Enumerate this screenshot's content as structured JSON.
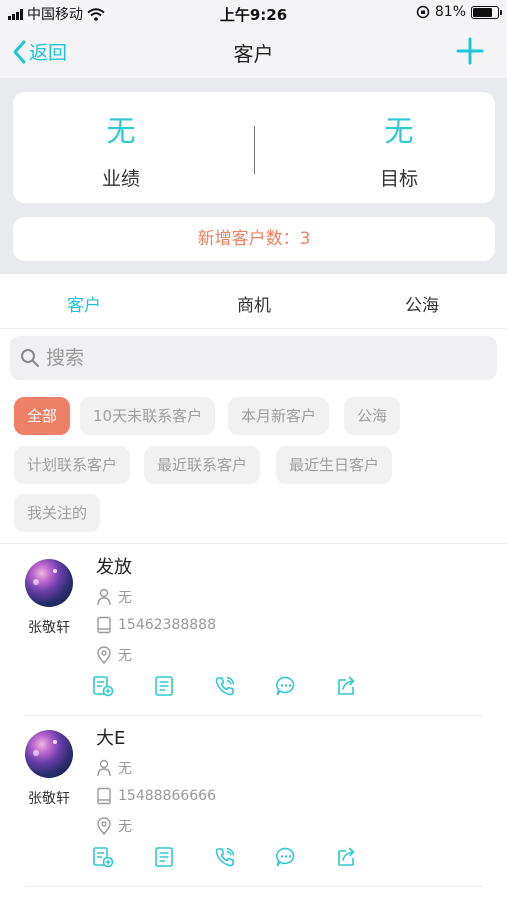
{
  "status_bar": {
    "carrier": "中国移动",
    "time": "上午9:26",
    "battery": "81%",
    "battery_level": 0.81
  },
  "navbar": {
    "back_label": "返回",
    "title": "客户"
  },
  "summary": {
    "metrics": [
      {
        "value": "无",
        "label": "业绩"
      },
      {
        "value": "无",
        "label": "目标"
      }
    ],
    "new_customers": "新增客户数：3"
  },
  "tabs": [
    "客户",
    "商机",
    "公海"
  ],
  "active_tab": 0,
  "search": {
    "placeholder": "搜索",
    "value": ""
  },
  "filters": [
    "全部",
    "10天未联系客户",
    "本月新客户",
    "公海",
    "计划联系客户",
    "最近联系客户",
    "最近生日客户",
    "我关注的"
  ],
  "active_filter": 0,
  "customers": [
    {
      "name": "发放",
      "owner": "张敬轩",
      "contact": "无",
      "phone": "15462388888",
      "address": "无"
    },
    {
      "name": "大E",
      "owner": "张敬轩",
      "contact": "无",
      "phone": "15488866666",
      "address": "无"
    }
  ],
  "accent_color": "#1cc6d6",
  "highlight_color": "#ef8068"
}
